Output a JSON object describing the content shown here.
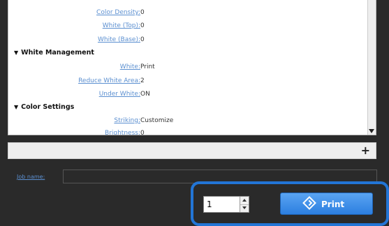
{
  "settings": {
    "rows_top": [
      {
        "label": "Color Density:",
        "value": "0"
      },
      {
        "label": "White (Top):",
        "value": "0"
      },
      {
        "label": "White (Base):",
        "value": "0"
      }
    ],
    "white_management": {
      "title": "White Management",
      "rows": [
        {
          "label": "White:",
          "value": "Print"
        },
        {
          "label": "Reduce White Area:",
          "value": "2"
        },
        {
          "label": "Under White:",
          "value": "ON"
        }
      ]
    },
    "color_settings": {
      "title": "Color Settings",
      "rows": [
        {
          "label": "Striking:",
          "value": "Customize"
        },
        {
          "label": "Brightness:",
          "value": "0"
        }
      ]
    }
  },
  "add_bar": {
    "plus": "+"
  },
  "job": {
    "label": "Job name:",
    "value": ""
  },
  "print": {
    "copies": "1",
    "button_label": "Print"
  },
  "colors": {
    "accent": "#2275d6",
    "button": "#3a8ae8",
    "link": "#5b8fd0"
  }
}
